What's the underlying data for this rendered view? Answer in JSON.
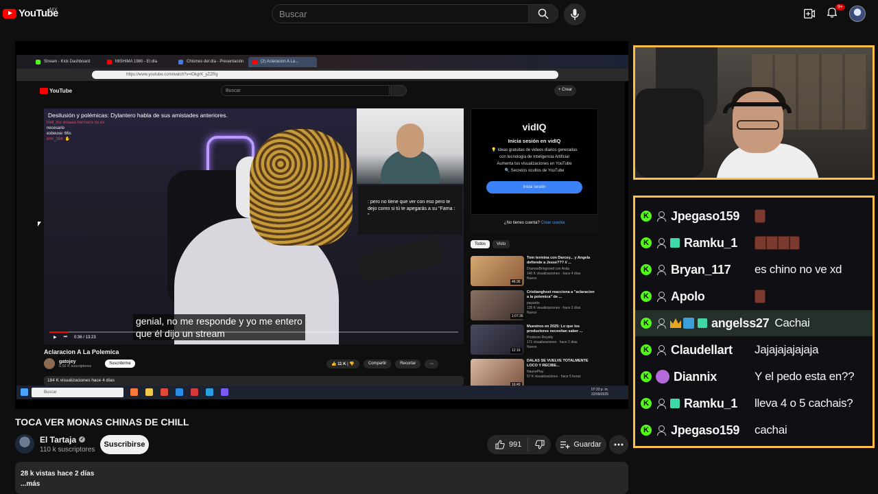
{
  "header": {
    "logo_text": "YouTube",
    "country": "MX",
    "search_placeholder": "Buscar",
    "notif_count": "9+"
  },
  "inner_browser": {
    "tabs": [
      {
        "label": "Stream - Kick Dashboard",
        "color": "#53fc18"
      },
      {
        "label": "MISHIMA 1980 - El día",
        "color": "#ff0000"
      },
      {
        "label": "Chismes del día - Presentación",
        "color": "#4a7bd8"
      },
      {
        "label": "(2) Aclaracion A La...",
        "color": "#ff0000"
      }
    ],
    "url": "https://www.youtube.com/watch?v=lOkgrK_yZZRg",
    "logo_text": "YouTube",
    "search_placeholder": "Buscar",
    "crear_label": "+ Crear",
    "overlay_title": "Desilusión y polémicas: Dylantero habla de sus amistades anteriores.",
    "mini_chat": [
      {
        "text": "Hell_tru: eraaaa hermano no es",
        "color": "#e0465c"
      },
      {
        "text": "necesario",
        "color": "#f1f1f1"
      },
      {
        "text": "esbeuse: 66s",
        "color": "#f1f1f1"
      },
      {
        "text": "enn_164: ✋",
        "color": "#e0465c"
      }
    ],
    "chat_inset": ": pero no tiene que ver con eso pero te dejo como si tú te apegarás a su \"Fama : \"",
    "caption_line1": "genial, no me responde y yo me entero",
    "caption_line2": "que él dijo un stream",
    "time": "0:36 / 13:23",
    "progress": 0.045,
    "video_title": "Aclaracion A La Polemica",
    "channel_name": "gatojey",
    "channel_subs": "6,92 K suscriptores",
    "subscribe_label": "Suscribirme",
    "likes": "11 K",
    "share_label": "Compartir",
    "clip_label": "Recortar",
    "desc": "184 K visualizaciones  hace 4 días",
    "vidiq": {
      "logo": "vidIQ",
      "heading": "Inicia sesión en vidIQ",
      "line1": "💡 Ideas gratuitas de videos diarios generadas",
      "line2": "con tecnología de Inteligencia Artificial",
      "line3": "Aumenta tus visualizaciones en YouTube",
      "line4": "🔍 Secretos ocultos de YouTube",
      "button": "Inicia sesión",
      "no_account": "¿No tienes cuenta?",
      "create": "Crear cuenta"
    },
    "chips": [
      "Todos",
      "Visto"
    ],
    "recs": [
      {
        "title": "Tom termina con Darcey... y Angela defiende a Jesse??? // ...",
        "channel": "DramasBringosed con Anita",
        "meta": "140 K visualizaciones · hace 4 días",
        "tag": "Nuevo",
        "duration": "46:36",
        "color": "#c49a63"
      },
      {
        "title": "Cristianghost reacciona a \"aclaracion a la polemica\" de ...",
        "channel": "payasito",
        "meta": "135 K visualizaciones · hace 2 días",
        "tag": "Nuevo",
        "duration": "1:07:36",
        "color": "#6b5a50"
      },
      {
        "title": "Muestreo en 2025: Lo que los productores necesitan saber ...",
        "channel": "Producer Royalty",
        "meta": "171 visualizaciones · hace 2 días",
        "tag": "Nuevo",
        "duration": "12:16",
        "color": "#3a3a4a"
      },
      {
        "title": "DALAS SE VUELVE TOTALMENTE LOCO Y RECIBE...",
        "channel": "NaunePlay",
        "meta": "57 K visualizaciones · hace 5 horas",
        "tag": "",
        "duration": "16:49",
        "color": "#b88a6e"
      }
    ],
    "taskbar_search": "Buscar",
    "clock_time": "07:33 p. m.",
    "clock_date": "22/09/2025"
  },
  "video": {
    "title": "TOCA VER MONAS CHINAS DE CHILL",
    "channel": "El Tartaja",
    "subs": "110 k suscriptores",
    "subscribe_label": "Suscribirse",
    "likes": "991",
    "save_label": "Guardar",
    "views": "28 k vistas  hace 2 días",
    "more": "...más"
  },
  "chat": [
    {
      "user": "Jpegaso159",
      "msg": "",
      "badges": [],
      "emotes": 1
    },
    {
      "user": "Ramku_1",
      "msg": "",
      "badges": [
        "gift"
      ],
      "emotes": 4
    },
    {
      "user": "Bryan_117",
      "msg": "es chino no ve xd",
      "badges": [],
      "emotes": 0
    },
    {
      "user": "Apolo",
      "msg": "",
      "badges": [],
      "emotes": 1
    },
    {
      "user": "angelss27",
      "msg": "Cachai",
      "badges": [
        "crown",
        "square",
        "gift"
      ],
      "emotes": 0,
      "highlight": true
    },
    {
      "user": "Claudellart",
      "msg": "Jajajajajajaja",
      "badges": [],
      "emotes": 0
    },
    {
      "user": "Diannix",
      "msg": "Y el pedo esta en??",
      "badges": [
        "avatar"
      ],
      "emotes": 0
    },
    {
      "user": "Ramku_1",
      "msg": "lleva 4 o 5 cachais?",
      "badges": [
        "gift"
      ],
      "emotes": 0
    },
    {
      "user": "Jpegaso159",
      "msg": "cachai",
      "badges": [],
      "emotes": 0
    }
  ],
  "colors": {
    "accent": "#ffbf47",
    "kick": "#53fc18",
    "yt_red": "#ff0000"
  }
}
